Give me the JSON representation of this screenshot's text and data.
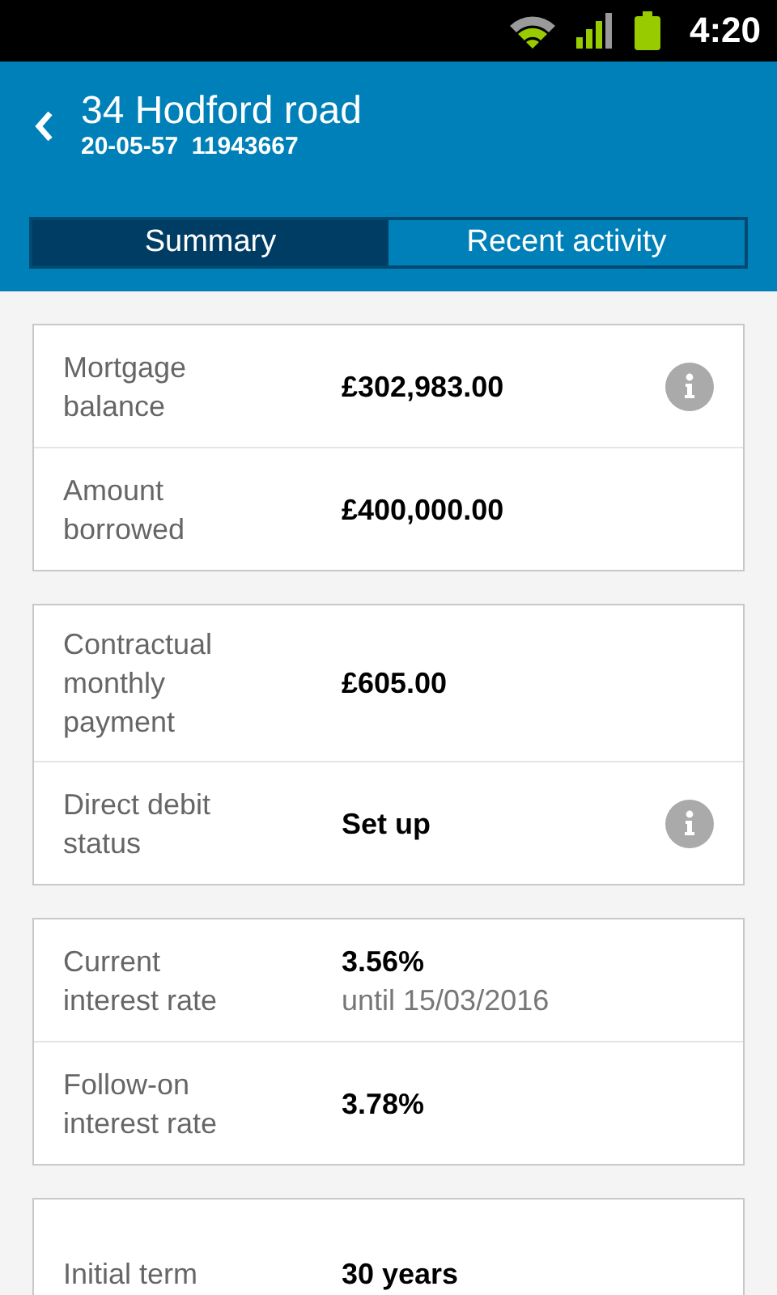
{
  "status_bar": {
    "time": "4:20"
  },
  "header": {
    "title": "34 Hodford road",
    "subtitle": "20-05-57  11943667"
  },
  "tabs": [
    {
      "label": "Summary",
      "selected": true
    },
    {
      "label": "Recent activity",
      "selected": false
    }
  ],
  "cards": [
    {
      "rows": [
        {
          "label": "Mortgage balance",
          "value": "£302,983.00",
          "info": true
        },
        {
          "label": "Amount borrowed",
          "value": "£400,000.00",
          "info": false
        }
      ]
    },
    {
      "rows": [
        {
          "label": "Contractual monthly payment",
          "value": "£605.00",
          "info": false
        },
        {
          "label": "Direct debit status",
          "value": "Set up",
          "info": true
        }
      ]
    },
    {
      "rows": [
        {
          "label": "Current interest rate",
          "value": "3.56%",
          "note": "until 15/03/2016",
          "info": false
        },
        {
          "label": "Follow-on interest rate",
          "value": "3.78%",
          "info": false
        }
      ]
    },
    {
      "rows": [
        {
          "label": "Initial term",
          "value": "30 years",
          "info": false
        }
      ]
    }
  ]
}
